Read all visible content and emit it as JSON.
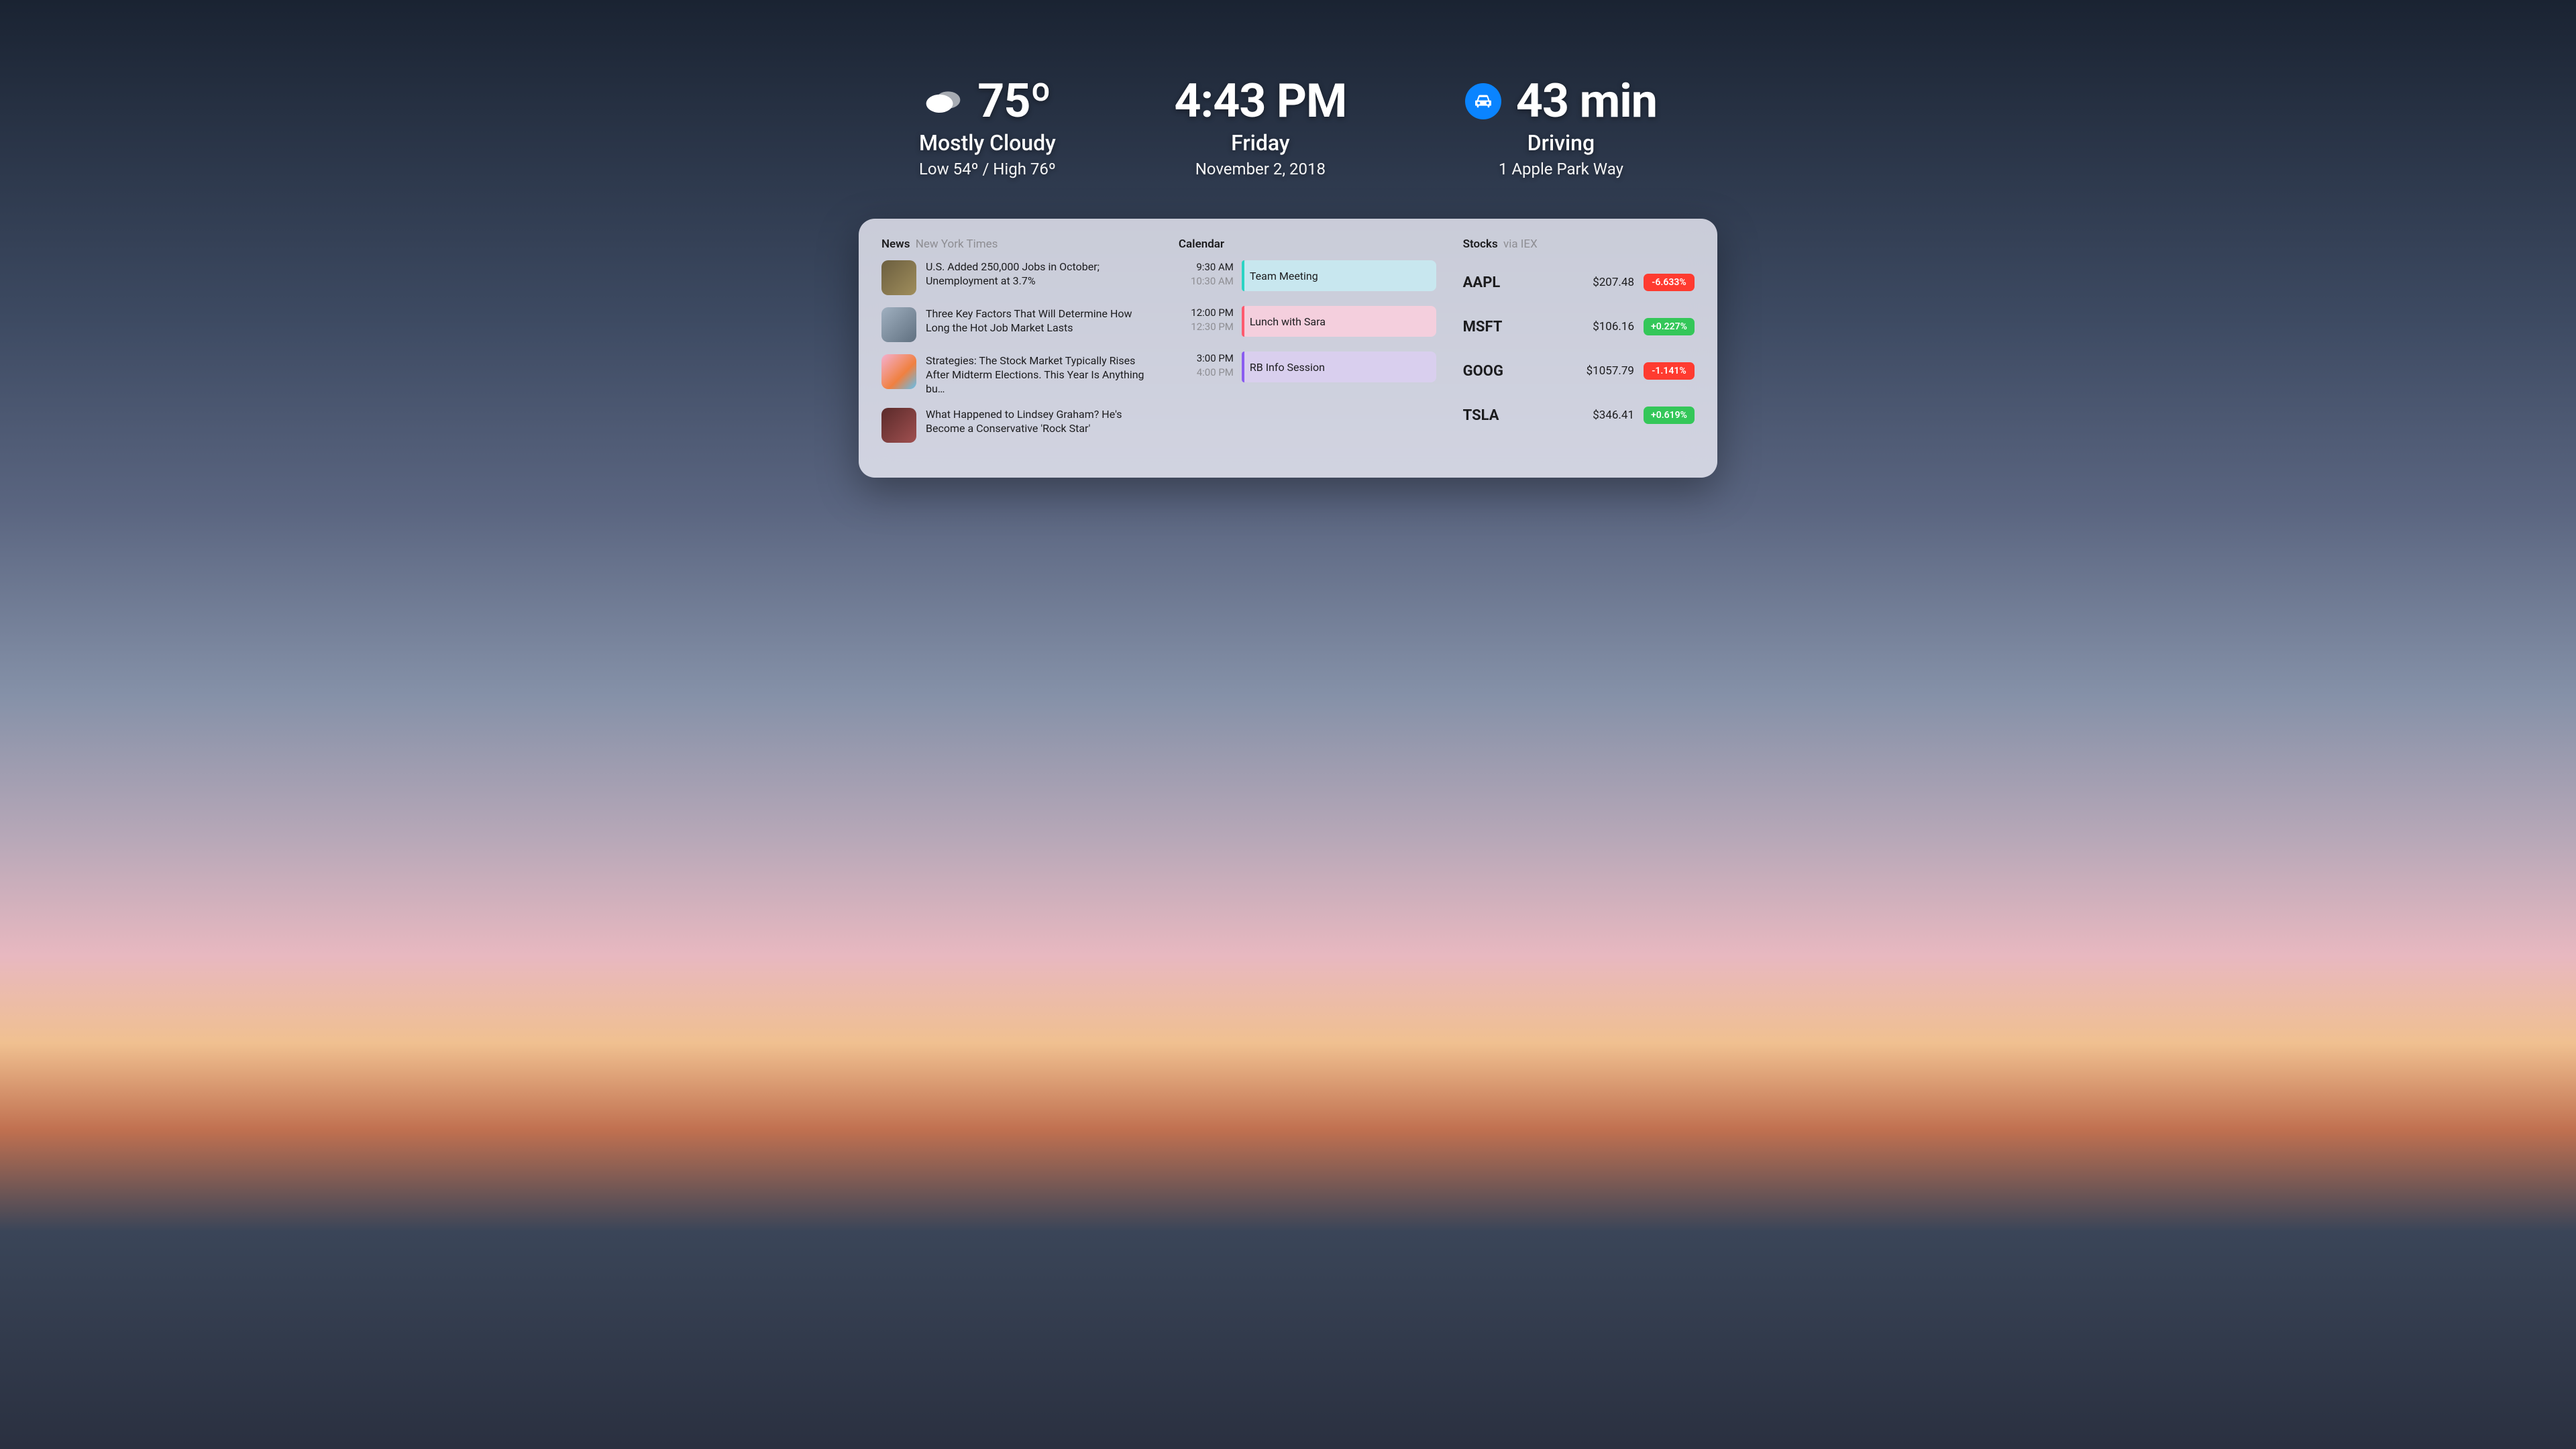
{
  "weather": {
    "temp": "75º",
    "condition": "Mostly Cloudy",
    "range": "Low 54º / High 76º"
  },
  "clock": {
    "time": "4:43 PM",
    "day": "Friday",
    "date": "November 2, 2018"
  },
  "commute": {
    "duration": "43 min",
    "mode": "Driving",
    "destination": "1 Apple Park Way"
  },
  "news": {
    "title": "News",
    "source": "New York Times",
    "items": [
      {
        "headline": "U.S. Added 250,000 Jobs in October; Unemployment at 3.7%"
      },
      {
        "headline": "Three Key Factors That Will Determine How Long the Hot Job Market Lasts"
      },
      {
        "headline": "Strategies: The Stock Market Typically Rises After Midterm Elections. This Year Is Anything bu…"
      },
      {
        "headline": "What Happened to Lindsey Graham? He's Become a Conservative 'Rock Star'"
      }
    ]
  },
  "calendar": {
    "title": "Calendar",
    "events": [
      {
        "start": "9:30 AM",
        "end": "10:30 AM",
        "title": "Team Meeting",
        "accent": "#2bd4c4",
        "bg": "#c8e7ef"
      },
      {
        "start": "12:00 PM",
        "end": "12:30 PM",
        "title": "Lunch with Sara",
        "accent": "#ff5a6e",
        "bg": "#f4cfdd"
      },
      {
        "start": "3:00 PM",
        "end": "4:00 PM",
        "title": "RB Info Session",
        "accent": "#8a5cf0",
        "bg": "#d9cfee"
      }
    ]
  },
  "stocks": {
    "title": "Stocks",
    "provider": "via IEX",
    "rows": [
      {
        "symbol": "AAPL",
        "price": "$207.48",
        "change": "-6.633%",
        "dir": "down"
      },
      {
        "symbol": "MSFT",
        "price": "$106.16",
        "change": "+0.227%",
        "dir": "up"
      },
      {
        "symbol": "GOOG",
        "price": "$1057.79",
        "change": "-1.141%",
        "dir": "down"
      },
      {
        "symbol": "TSLA",
        "price": "$346.41",
        "change": "+0.619%",
        "dir": "up"
      }
    ]
  }
}
